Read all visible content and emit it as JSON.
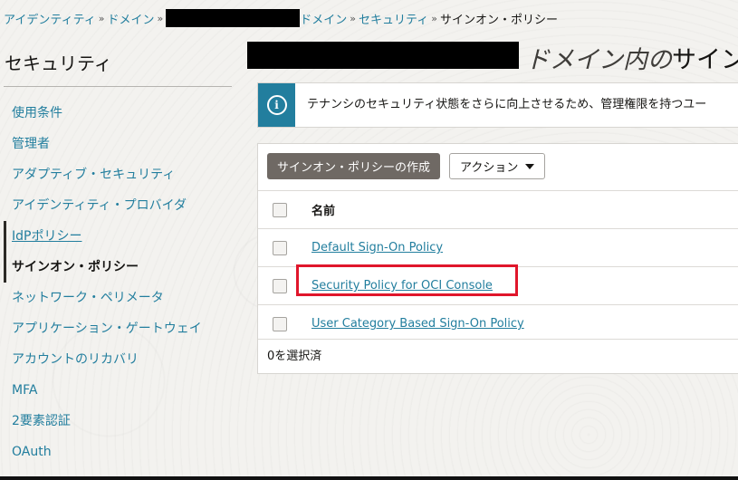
{
  "breadcrumb": {
    "identity": "アイデンティティ",
    "domains": "ドメイン",
    "domain_suffix": "ドメイン",
    "security": "セキュリティ",
    "current": "サインオン・ポリシー",
    "separator": "»"
  },
  "sidebar": {
    "title": "セキュリティ",
    "items": [
      {
        "label": "使用条件"
      },
      {
        "label": "管理者"
      },
      {
        "label": "アダプティブ・セキュリティ"
      },
      {
        "label": "アイデンティティ・プロバイダ"
      },
      {
        "label": "IdPポリシー"
      },
      {
        "label": "サインオン・ポリシー"
      },
      {
        "label": "ネットワーク・ペリメータ"
      },
      {
        "label": "アプリケーション・ゲートウェイ"
      },
      {
        "label": "アカウントのリカバリ"
      },
      {
        "label": "MFA"
      },
      {
        "label": "2要素認証"
      },
      {
        "label": "OAuth"
      }
    ],
    "active_index": 5
  },
  "page": {
    "title_prefix": "ドメイン内の",
    "title_main": "サイン"
  },
  "info_banner": {
    "icon": "info-icon",
    "icon_glyph": "i",
    "text": "テナンシのセキュリティ状態をさらに向上させるため、管理権限を持つユー"
  },
  "toolbar": {
    "create_label": "サインオン・ポリシーの作成",
    "actions_label": "アクション"
  },
  "table": {
    "header_name": "名前",
    "rows": [
      {
        "name": "Default Sign-On Policy"
      },
      {
        "name": "Security Policy for OCI Console"
      },
      {
        "name": "User Category Based Sign-On Policy"
      }
    ],
    "selected_text": "0を選択済"
  },
  "colors": {
    "link": "#227e9e",
    "primary_button": "#6f6964",
    "highlight": "#e0162b"
  }
}
